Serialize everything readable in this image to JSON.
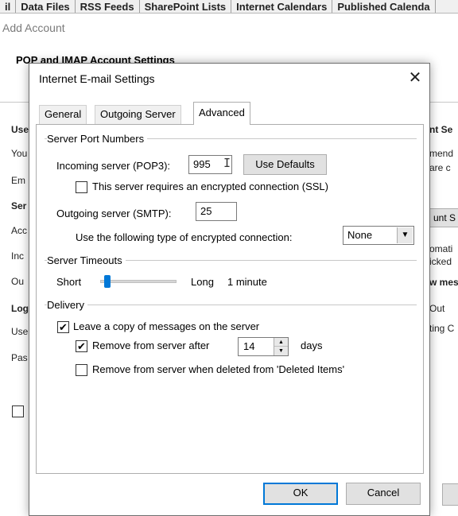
{
  "background": {
    "tabs": [
      "il",
      "Data Files",
      "RSS Feeds",
      "SharePoint Lists",
      "Internet Calendars",
      "Published Calenda"
    ],
    "window_title": "Add Account",
    "section_heading": "POP and IMAP Account Settings",
    "left_fragments": [
      "Use",
      "You",
      "Em",
      "Ser",
      "Acc",
      "Inc",
      "Ou",
      "Log",
      "Use",
      "Pas"
    ],
    "right_fragments": [
      "nt Se",
      "mend",
      "are c",
      "unt S",
      "omati",
      "icked",
      "w mes",
      "Out",
      "ting C"
    ]
  },
  "dialog": {
    "title": "Internet E-mail Settings",
    "close_label": "✕",
    "tabs": [
      {
        "label": "General"
      },
      {
        "label": "Outgoing Server"
      },
      {
        "label": "Advanced"
      }
    ],
    "server_ports": {
      "heading": "Server Port Numbers",
      "incoming_label": "Incoming server (POP3):",
      "incoming_value": "995",
      "use_defaults_label": "Use Defaults",
      "ssl_label": "This server requires an encrypted connection (SSL)",
      "ssl_checked": false,
      "outgoing_label": "Outgoing server (SMTP):",
      "outgoing_value": "25",
      "encryption_label": "Use the following type of encrypted connection:",
      "encryption_value": "None"
    },
    "timeouts": {
      "heading": "Server Timeouts",
      "short_label": "Short",
      "long_label": "Long",
      "value_label": "1 minute",
      "slider_level": 0.1
    },
    "delivery": {
      "heading": "Delivery",
      "leave_copy_label": "Leave a copy of messages on the server",
      "leave_copy_checked": true,
      "remove_after_label": "Remove from server after",
      "remove_after_checked": true,
      "days_value": "14",
      "days_label": "days",
      "remove_deleted_label": "Remove from server when deleted from 'Deleted Items'",
      "remove_deleted_checked": false
    },
    "footer": {
      "ok_label": "OK",
      "cancel_label": "Cancel"
    }
  },
  "colors": {
    "accent": "#0078d7",
    "button_face": "#e1e1e1",
    "border": "#adadad"
  }
}
